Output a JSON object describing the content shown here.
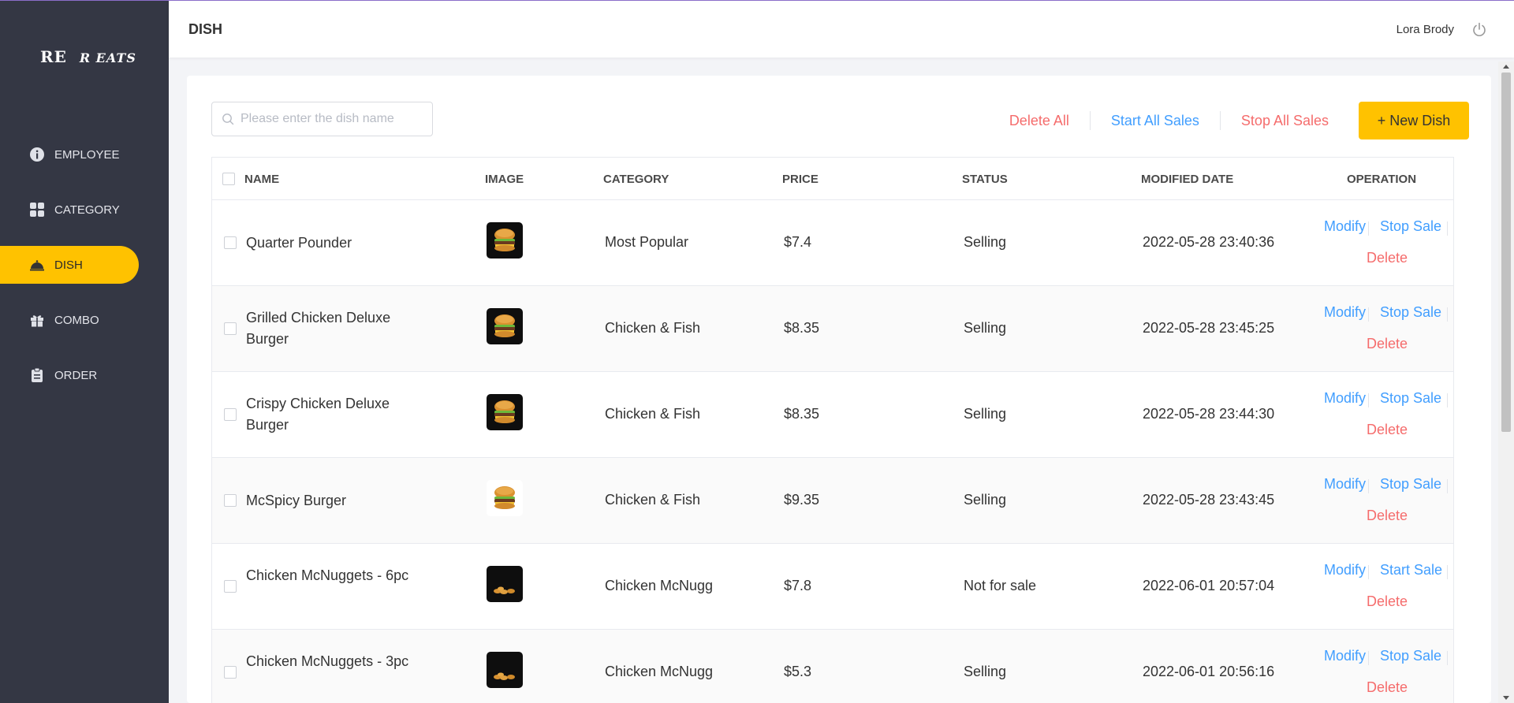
{
  "app": {
    "logo_main": "RE",
    "logo_rest": "R EATS",
    "page_title": "DISH",
    "user_name": "Lora Brody"
  },
  "sidebar": {
    "items": [
      {
        "label": "EMPLOYEE",
        "icon": "info-icon",
        "active": false
      },
      {
        "label": "CATEGORY",
        "icon": "grid-icon",
        "active": false
      },
      {
        "label": "DISH",
        "icon": "cloche-icon",
        "active": true
      },
      {
        "label": "COMBO",
        "icon": "gift-icon",
        "active": false
      },
      {
        "label": "ORDER",
        "icon": "clipboard-icon",
        "active": false
      }
    ]
  },
  "toolbar": {
    "search_placeholder": "Please enter the dish name",
    "delete_all": "Delete All",
    "start_all": "Start All Sales",
    "stop_all": "Stop All Sales",
    "new_dish": "+ New Dish"
  },
  "table": {
    "headers": {
      "name": "NAME",
      "image": "IMAGE",
      "category": "CATEGORY",
      "price": "PRICE",
      "status": "STATUS",
      "modified": "MODIFIED DATE",
      "operation": "OPERATION"
    },
    "op_modify": "Modify",
    "op_delete": "Delete",
    "rows": [
      {
        "name": "Quarter Pounder",
        "category": "Most Popular",
        "price": "$7.4",
        "status": "Selling",
        "modified": "2022-05-28 23:40:36",
        "toggle": "Stop Sale",
        "image": "burger-image"
      },
      {
        "name": "Grilled Chicken Deluxe Burger",
        "category": "Chicken & Fish",
        "price": "$8.35",
        "status": "Selling",
        "modified": "2022-05-28 23:45:25",
        "toggle": "Stop Sale",
        "image": "burger-image"
      },
      {
        "name": "Crispy Chicken Deluxe Burger",
        "category": "Chicken & Fish",
        "price": "$8.35",
        "status": "Selling",
        "modified": "2022-05-28 23:44:30",
        "toggle": "Stop Sale",
        "image": "burger-image"
      },
      {
        "name": "McSpicy Burger",
        "category": "Chicken & Fish",
        "price": "$9.35",
        "status": "Selling",
        "modified": "2022-05-28 23:43:45",
        "toggle": "Stop Sale",
        "image": "burger-image"
      },
      {
        "name": "Chicken McNuggets - 6pc",
        "category": "Chicken McNugg",
        "price": "$7.8",
        "status": "Not for sale",
        "modified": "2022-06-01 20:57:04",
        "toggle": "Start Sale",
        "image": "nuggets-image"
      },
      {
        "name": "Chicken McNuggets - 3pc",
        "category": "Chicken McNugg",
        "price": "$5.3",
        "status": "Selling",
        "modified": "2022-06-01 20:56:16",
        "toggle": "Stop Sale",
        "image": "nuggets-image"
      }
    ]
  },
  "colors": {
    "sidebar_bg": "#343744",
    "accent": "#ffc200",
    "link_blue": "#419eff",
    "danger_red": "#f56c6c"
  }
}
